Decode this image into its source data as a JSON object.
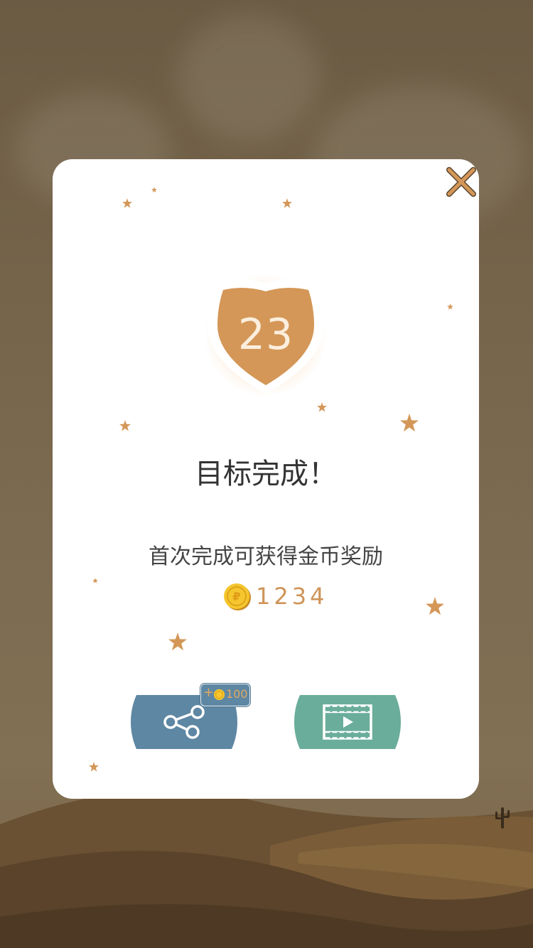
{
  "level": {
    "number": "23"
  },
  "dialog": {
    "title": "目标完成！",
    "subtitle": "首次完成可获得金币奖励",
    "reward_amount": "1234"
  },
  "share_bonus": {
    "plus": "+",
    "amount": "100"
  },
  "icons": {
    "close": "close-icon",
    "coin": "coin-icon",
    "share": "share-icon",
    "video": "video-play-icon",
    "badge": "shield-badge",
    "cactus": "cactus-icon"
  },
  "colors": {
    "accent": "#d49758",
    "share_button": "#5e87a3",
    "video_button": "#6aad9a",
    "star": "#d49758",
    "reward_text": "#cf9458"
  }
}
